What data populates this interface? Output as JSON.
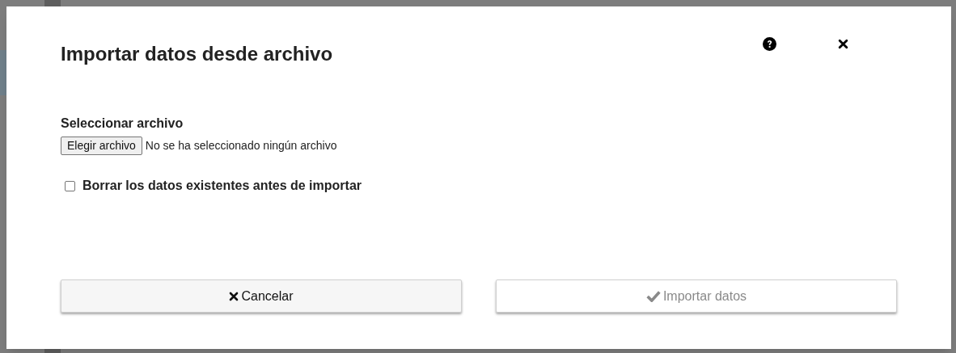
{
  "dialog": {
    "title": "Importar datos desde archivo",
    "file": {
      "label": "Seleccionar archivo",
      "button": "Elegir archivo",
      "status": "No se ha seleccionado ningún archivo"
    },
    "option": {
      "label": "Borrar los datos existentes antes de importar",
      "checked": false
    },
    "buttons": [
      {
        "kind": "cancel",
        "label": "Cancelar",
        "disabled": false
      },
      {
        "kind": "import",
        "label": "Importar datos",
        "disabled": true
      }
    ]
  }
}
